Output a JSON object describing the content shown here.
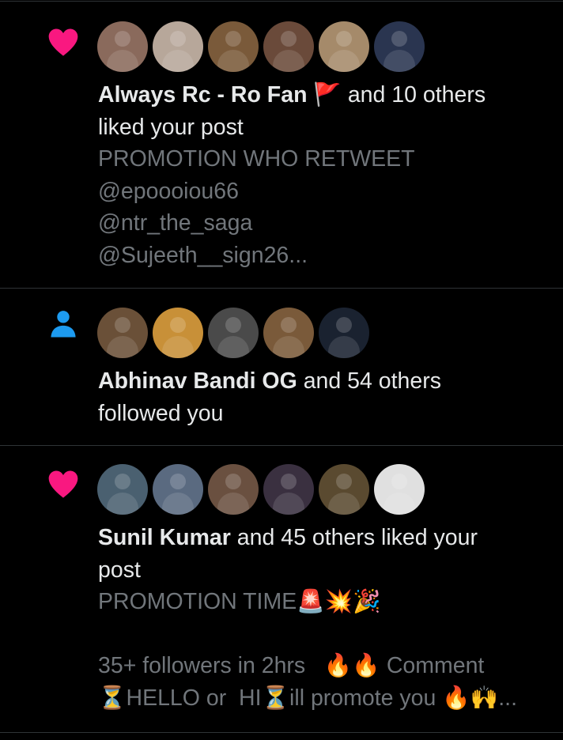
{
  "colors": {
    "background": "#000000",
    "divider": "#2f3336",
    "text_primary": "#e7e9ea",
    "text_muted": "#71767b",
    "heart": "#f91880",
    "person": "#1d9bf0"
  },
  "notifications": [
    {
      "icon": "heart-icon",
      "avatars": [
        {
          "color": "#8a6a5c"
        },
        {
          "color": "#b7a79a"
        },
        {
          "color": "#7a5a3a"
        },
        {
          "color": "#6a4a3a"
        },
        {
          "color": "#a58a6a"
        },
        {
          "color": "#2a3550"
        }
      ],
      "actor": "Always Rc - Ro Fan",
      "actor_emoji": "🚩",
      "action_inline": " and 10 others",
      "action_cont": "liked your post",
      "preview": [
        "PROMOTION WHO RETWEET",
        "@epoooiou66",
        "@ntr_the_saga",
        "@Sujeeth__sign26..."
      ]
    },
    {
      "icon": "person-icon",
      "avatars": [
        {
          "color": "#6a5038"
        },
        {
          "color": "#c89038"
        },
        {
          "color": "#4a4a4a"
        },
        {
          "color": "#7a5a3a"
        },
        {
          "color": "#1a2230"
        }
      ],
      "actor": "Abhinav Bandi OG",
      "action_inline": " and 54 others",
      "action_cont": "followed you"
    },
    {
      "icon": "heart-icon",
      "avatars": [
        {
          "color": "#4a6070"
        },
        {
          "color": "#5a6a80"
        },
        {
          "color": "#6a5040"
        },
        {
          "color": "#3a3040"
        },
        {
          "color": "#5a4a30"
        },
        {
          "color": "#e0e0e0"
        }
      ],
      "actor": "Sunil Kumar",
      "action_inline": " and 45 others liked your",
      "action_cont": "post",
      "preview": [
        "PROMOTION TIME🚨💥🎉",
        "",
        "35+ followers in 2hrs   🔥🔥 Comment",
        "⏳HELLO or  HI⏳ill promote you 🔥🙌..."
      ]
    }
  ]
}
